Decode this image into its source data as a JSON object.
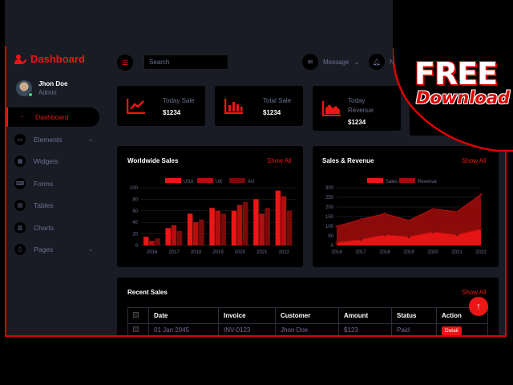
{
  "brand": {
    "name": "Dashboard",
    "icon": "user-edit-icon"
  },
  "profile": {
    "name": "Jhon Doe",
    "role": "Admin"
  },
  "sidebar": {
    "items": [
      {
        "label": "Dashboard",
        "icon": "tachometer-icon",
        "active": true,
        "dropdown": false
      },
      {
        "label": "Elements",
        "icon": "laptop-icon",
        "active": false,
        "dropdown": true
      },
      {
        "label": "Widgets",
        "icon": "th-icon",
        "active": false,
        "dropdown": false
      },
      {
        "label": "Forms",
        "icon": "keyboard-icon",
        "active": false,
        "dropdown": false
      },
      {
        "label": "Tables",
        "icon": "table-icon",
        "active": false,
        "dropdown": false
      },
      {
        "label": "Charts",
        "icon": "chart-bar-icon",
        "active": false,
        "dropdown": false
      },
      {
        "label": "Pages",
        "icon": "file-icon",
        "active": false,
        "dropdown": true
      }
    ]
  },
  "topbar": {
    "search_placeholder": "Search",
    "message_label": "Message",
    "notif_label": "N"
  },
  "stats": [
    {
      "label": "Today Sale",
      "value": "$1234",
      "icon": "chart-line-icon"
    },
    {
      "label": "Total Sale",
      "value": "$1234",
      "icon": "chart-bar-icon"
    },
    {
      "label": "Today Revenue",
      "value": "$1234",
      "icon": "chart-area-icon"
    }
  ],
  "worldwide": {
    "title": "Worldwide Sales",
    "link": "Show All",
    "chart_data": {
      "type": "bar",
      "categories": [
        "2016",
        "2017",
        "2018",
        "2019",
        "2020",
        "2021",
        "2022"
      ],
      "series": [
        {
          "name": "USA",
          "values": [
            15,
            30,
            55,
            65,
            60,
            80,
            95
          ]
        },
        {
          "name": "UK",
          "values": [
            8,
            35,
            40,
            60,
            70,
            55,
            85
          ]
        },
        {
          "name": "AU",
          "values": [
            12,
            25,
            45,
            55,
            75,
            65,
            60
          ]
        }
      ],
      "ylim": [
        0,
        100
      ],
      "yticks": [
        0,
        20,
        40,
        60,
        80,
        100
      ],
      "colors": [
        "#eb1616",
        "#b20f0f",
        "#7a0a0a"
      ]
    }
  },
  "salesrev": {
    "title": "Sales & Revenue",
    "link": "Show All",
    "chart_data": {
      "type": "area",
      "categories": [
        "2016",
        "2017",
        "2018",
        "2019",
        "2020",
        "2021",
        "2022"
      ],
      "series": [
        {
          "name": "Sales",
          "values": [
            15,
            30,
            55,
            45,
            70,
            55,
            85
          ]
        },
        {
          "name": "Revenue",
          "values": [
            99,
            135,
            165,
            130,
            190,
            175,
            265
          ]
        }
      ],
      "ylim": [
        0,
        300
      ],
      "yticks": [
        0,
        50,
        100,
        150,
        200,
        250,
        300
      ],
      "colors": [
        "#eb1616",
        "#a30d0d"
      ]
    }
  },
  "recent": {
    "title": "Recent Sales",
    "link": "Show All",
    "headers": [
      "Date",
      "Invoice",
      "Customer",
      "Amount",
      "Status",
      "Action"
    ],
    "rows": [
      [
        "01 Jan 2045",
        "INV-0123",
        "Jhon Doe",
        "$123",
        "Paid",
        "Detail"
      ]
    ]
  },
  "promo": {
    "line1": "FREE",
    "line2": "Download"
  },
  "colors": {
    "accent": "#eb1616",
    "bg": "#191c24",
    "card": "#000000",
    "muted": "#6c7293"
  }
}
